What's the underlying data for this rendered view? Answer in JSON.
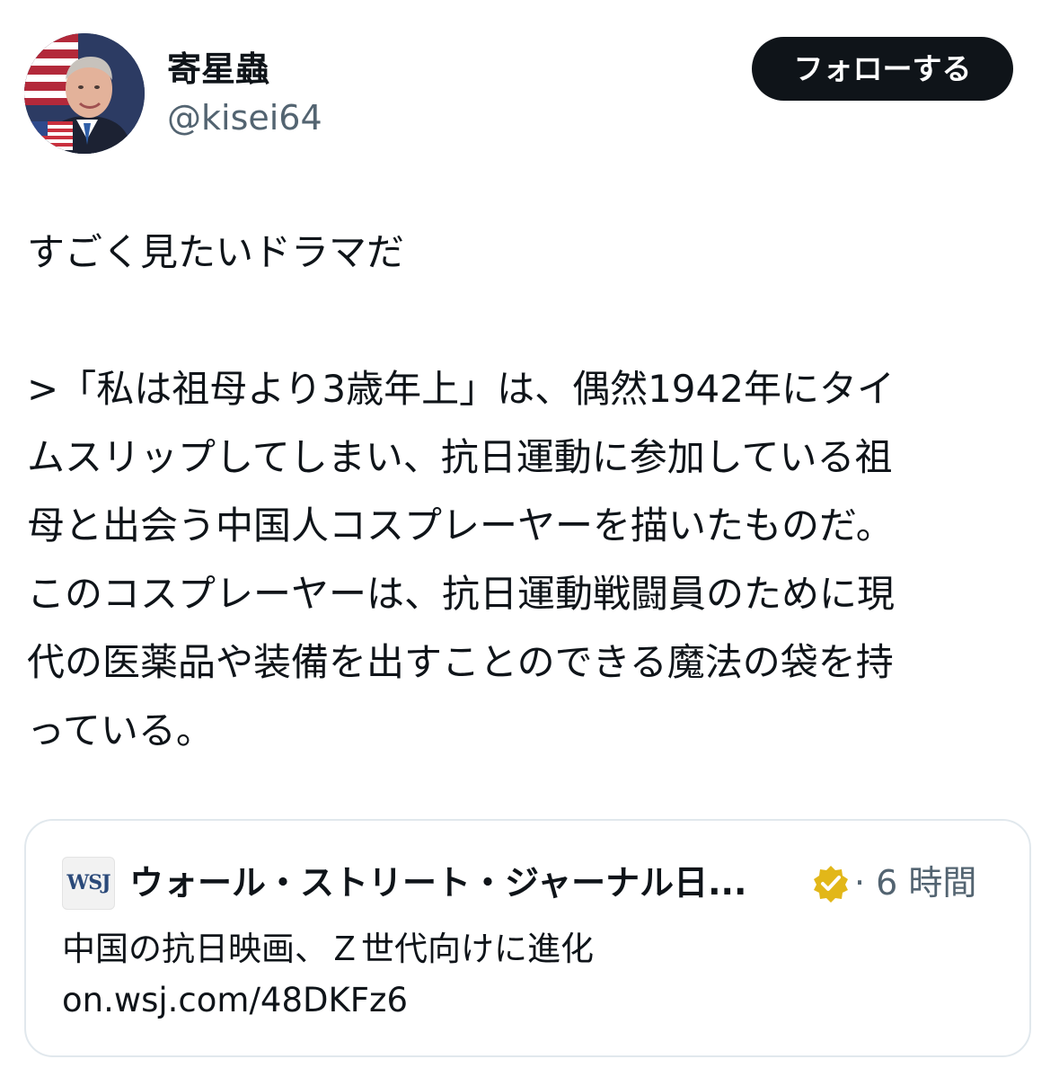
{
  "author": {
    "display_name": "寄星蟲",
    "handle": "@kisei64"
  },
  "follow_button": {
    "label": "フォローする"
  },
  "tweet": {
    "lines": [
      "すごく見たいドラマだ",
      "",
      ">「私は祖母より3歳年上」は、偶然1942年にタイ",
      "ムスリップしてしまい、抗日運動に参加している祖",
      "母と出会う中国人コスプレーヤーを描いたものだ。",
      "このコスプレーヤーは、抗日運動戦闘員のために現",
      "代の医薬品や装備を出すことのできる魔法の袋を持",
      "っている。"
    ]
  },
  "quoted_post": {
    "source_logo": "WSJ",
    "source_name": "ウォール・ストリート・ジャーナル日...",
    "verified_icon": "gold-verified-badge",
    "timestamp": "· 6 時間",
    "headline": "中国の抗日映画、Ｚ世代向けに進化",
    "url": "on.wsj.com/48DKFz6"
  },
  "colors": {
    "text_primary": "#0f1419",
    "text_secondary": "#536471",
    "follow_button_bg": "#0f1419",
    "card_border": "#e1e8ed",
    "verified_gold": "#e2b719"
  }
}
